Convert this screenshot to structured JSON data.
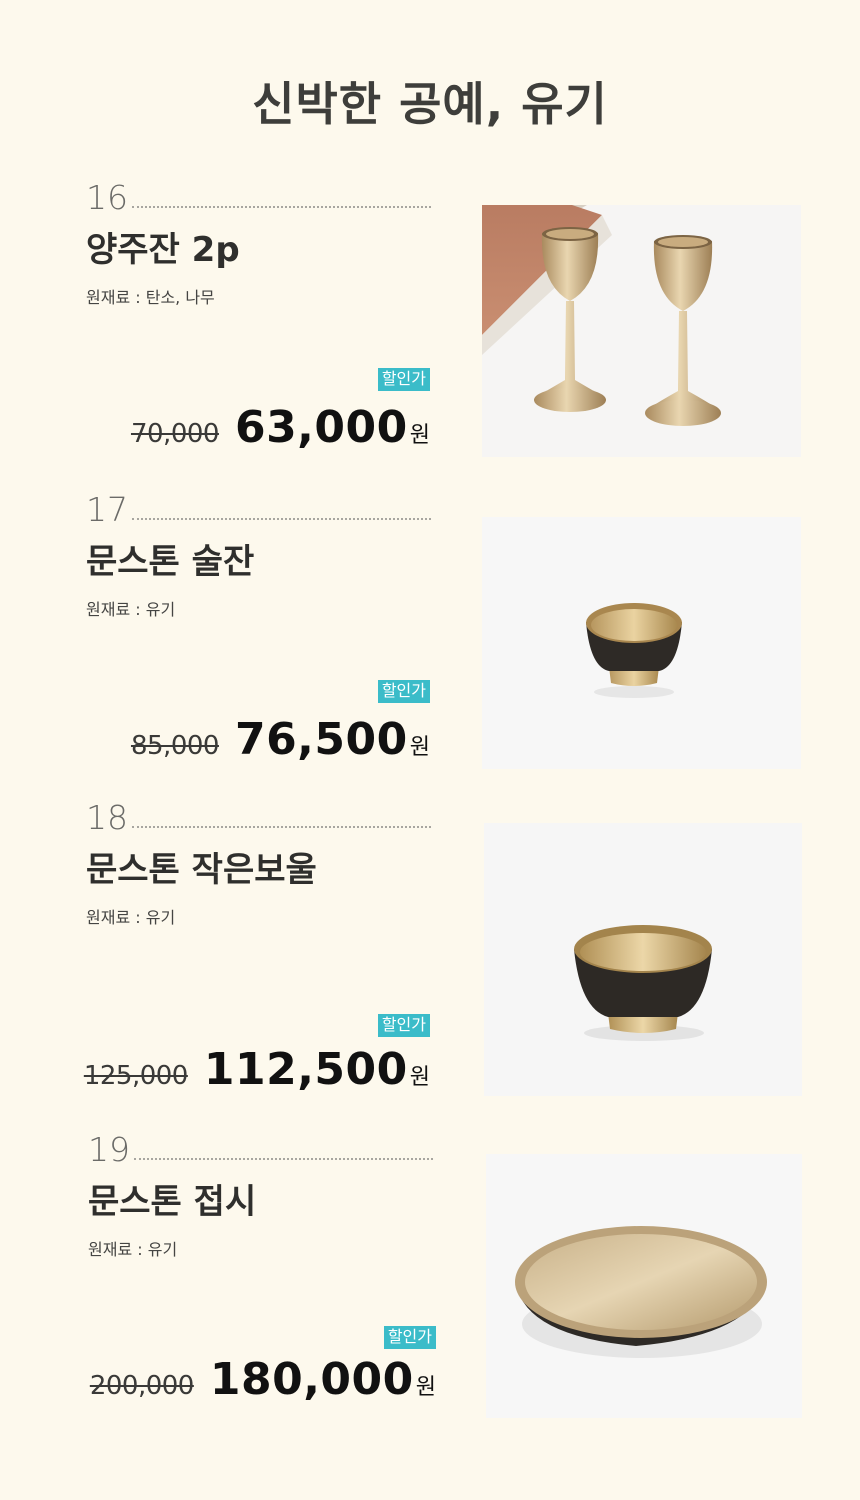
{
  "page": {
    "title": "신박한 공예, 유기"
  },
  "products": [
    {
      "number": "16",
      "name": "양주잔 2p",
      "material": "원재료 : 탄소, 나무",
      "badge": "할인가",
      "original_price": "70,000",
      "sale_price": "63,000",
      "currency": "원",
      "image_icon": "wine-goblets-image"
    },
    {
      "number": "17",
      "name": "문스톤 술잔",
      "material": "원재료 : 유기",
      "badge": "할인가",
      "original_price": "85,000",
      "sale_price": "76,500",
      "currency": "원",
      "image_icon": "cup-image"
    },
    {
      "number": "18",
      "name": "문스톤 작은보울",
      "material": "원재료 : 유기",
      "badge": "할인가",
      "original_price": "125,000",
      "sale_price": "112,500",
      "currency": "원",
      "image_icon": "bowl-image"
    },
    {
      "number": "19",
      "name": "문스톤 접시",
      "material": "원재료 : 유기",
      "badge": "할인가",
      "original_price": "200,000",
      "sale_price": "180,000",
      "currency": "원",
      "image_icon": "plate-image"
    }
  ],
  "colors": {
    "background": "#fdf9ed",
    "badge": "#3bbcc9",
    "brass": "#cdb07f",
    "dark_bronze": "#2e2a26"
  }
}
